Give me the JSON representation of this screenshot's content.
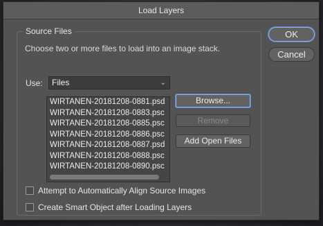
{
  "dialog": {
    "title": "Load Layers"
  },
  "source_files": {
    "group_title": "Source Files",
    "instructions": "Choose two or more files to load into an image stack.",
    "use_label": "Use:",
    "use_selected": "Files",
    "files": [
      "WIRTANEN-20181208-0881.psd",
      "WIRTANEN-20181208-0883.psc",
      "WIRTANEN-20181208-0885.psc",
      "WIRTANEN-20181208-0886.psc",
      "WIRTANEN-20181208-0887.psd",
      "WIRTANEN-20181208-0888.psc",
      "WIRTANEN-20181208-0890.psc"
    ],
    "browse_label": "Browse...",
    "remove_label": "Remove",
    "add_open_files_label": "Add Open Files"
  },
  "options": {
    "align_label": "Attempt to Automatically Align Source Images",
    "align_checked": false,
    "smart_object_label": "Create Smart Object after Loading Layers",
    "smart_object_checked": false
  },
  "actions": {
    "ok_label": "OK",
    "cancel_label": "Cancel"
  },
  "icons": {
    "select_chevron": "chevron-down-icon"
  }
}
